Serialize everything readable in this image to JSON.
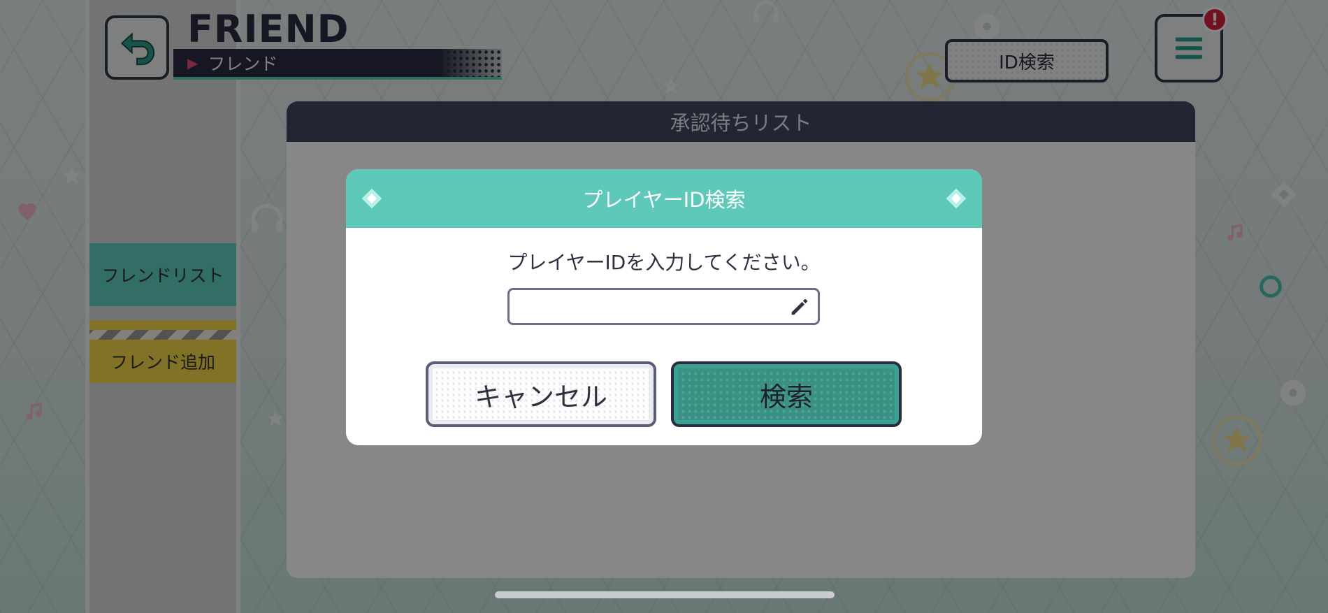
{
  "header": {
    "title_en": "FRIEND",
    "title_jp": "フレンド",
    "id_search_label": "ID検索",
    "notice_badge": "!"
  },
  "sidebar": {
    "items": [
      {
        "label": "フレンドリスト",
        "active": true
      },
      {
        "label": "フレンド追加",
        "active": false
      }
    ]
  },
  "panel": {
    "title": "承認待ちリスト"
  },
  "dialog": {
    "title": "プレイヤーID検索",
    "prompt": "プレイヤーIDを入力してください。",
    "input_value": "",
    "cancel_label": "キャンセル",
    "search_label": "検索"
  },
  "colors": {
    "accent_teal": "#5fc9b9",
    "header_navy": "#434463",
    "alert_red": "#d8233d",
    "add_tab_yellow": "#f4d84a"
  },
  "icons": {
    "back": "back-arrow-icon",
    "menu": "hamburger-menu-icon",
    "edit": "pencil-icon",
    "header_ornament": "diamond-icon"
  }
}
